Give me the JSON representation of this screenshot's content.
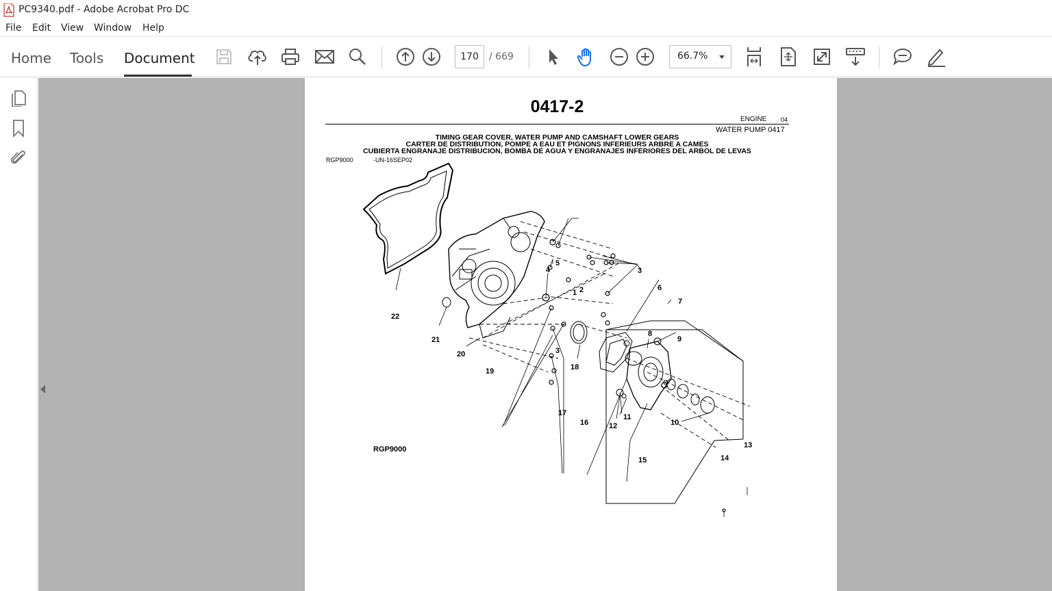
{
  "window": {
    "title": "PC9340.pdf - Adobe Acrobat Pro DC"
  },
  "menu": {
    "items": [
      "File",
      "Edit",
      "View",
      "Window",
      "Help"
    ]
  },
  "tabs": {
    "home": "Home",
    "tools": "Tools",
    "document": "Document"
  },
  "nav": {
    "current_page": "170",
    "total_pages": "/ 669"
  },
  "zoom": {
    "value": "66.7%"
  },
  "colors": {
    "accent": "#1473e6",
    "viewer_bg": "#b2b2b2",
    "icon": "#555555"
  },
  "document": {
    "heading": "0417-2",
    "section_label": "ENGINE",
    "section_code": "04",
    "subsection": "WATER PUMP 0417",
    "caption_en": "TIMING GEAR COVER, WATER PUMP AND CAMSHAFT LOWER GEARS",
    "caption_fr": "CARTER DE DISTRIBUTION, POMPE A EAU ET PIGNONS INFERIEURS ARBRE A CAMES",
    "caption_es": "CUBIERTA ENGRANAJE DISTRIBUCION, BOMBA DE AGUA Y ENGRANAJES INFERIORES DEL ARBOL DE LEVAS",
    "ref_code": "RGP9000",
    "ref_date": "-UN-16SEP02",
    "figure_id": "RGP9000",
    "callouts": [
      "1",
      "2",
      "3",
      "4",
      "5",
      "6",
      "7",
      "8",
      "9",
      "10",
      "11",
      "12",
      "13",
      "14",
      "15",
      "16",
      "17",
      "18",
      "19",
      "20",
      "21",
      "22",
      "3"
    ]
  }
}
